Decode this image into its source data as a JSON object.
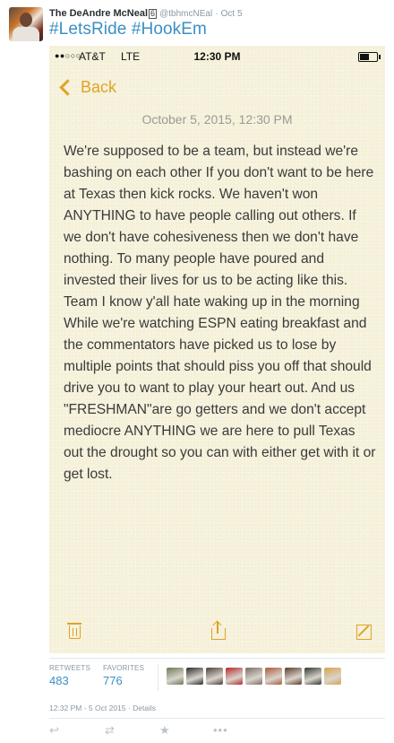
{
  "tweet": {
    "display_name": "The DeAndre McNeal",
    "badge": "6",
    "handle": "@tbhmcNEal",
    "separator": "·",
    "time": "Oct 5",
    "text": "#LetsRide #HookEm"
  },
  "phone": {
    "status": {
      "signal": "●●○○○",
      "carrier": "AT&T",
      "network": "LTE",
      "time": "12:30 PM"
    },
    "back_label": "Back",
    "note_date": "October 5, 2015, 12:30 PM",
    "note_body": "We're supposed to be a team, but instead we're bashing on each other If you don't want to be here at Texas then kick rocks. We haven't won  ANYTHING to have people calling out others. If we don't have cohesiveness then we don't have nothing. To many people have poured and invested their lives for us to be acting like this. Team I know y'all  hate waking up in the morning While we're watching ESPN eating breakfast and the commentators have picked us to lose by multiple points that should piss you off that should drive you to want to play your heart out. And us \"FRESHMAN\"are go getters and we don't accept mediocre ANYTHING we are here to pull Texas out the drought so you can with either get with it or get lost.",
    "toolbar_icons": [
      "trash-icon",
      "share-icon",
      "compose-icon"
    ],
    "accent_color": "#e0a326"
  },
  "stats": {
    "retweets_label": "RETWEETS",
    "retweets": "483",
    "favorites_label": "FAVORITES",
    "favorites": "776"
  },
  "favoriters_colors": [
    "#6b7a55",
    "#2b2b2b",
    "#4a4038",
    "#b32a2a",
    "#7a6c66",
    "#a85a3a",
    "#5b3b2a",
    "#2f3a2f",
    "#d8a24a"
  ],
  "meta": "12:32 PM - 5 Oct 2015 · Details",
  "actions": {
    "reply_icon": "reply-icon",
    "retweet_icon": "retweet-icon",
    "favorite_icon": "star-icon",
    "more_icon": "more-icon",
    "reply_glyph": "↩",
    "retweet_glyph": "⇄",
    "favorite_glyph": "★",
    "more_glyph": "•••"
  }
}
